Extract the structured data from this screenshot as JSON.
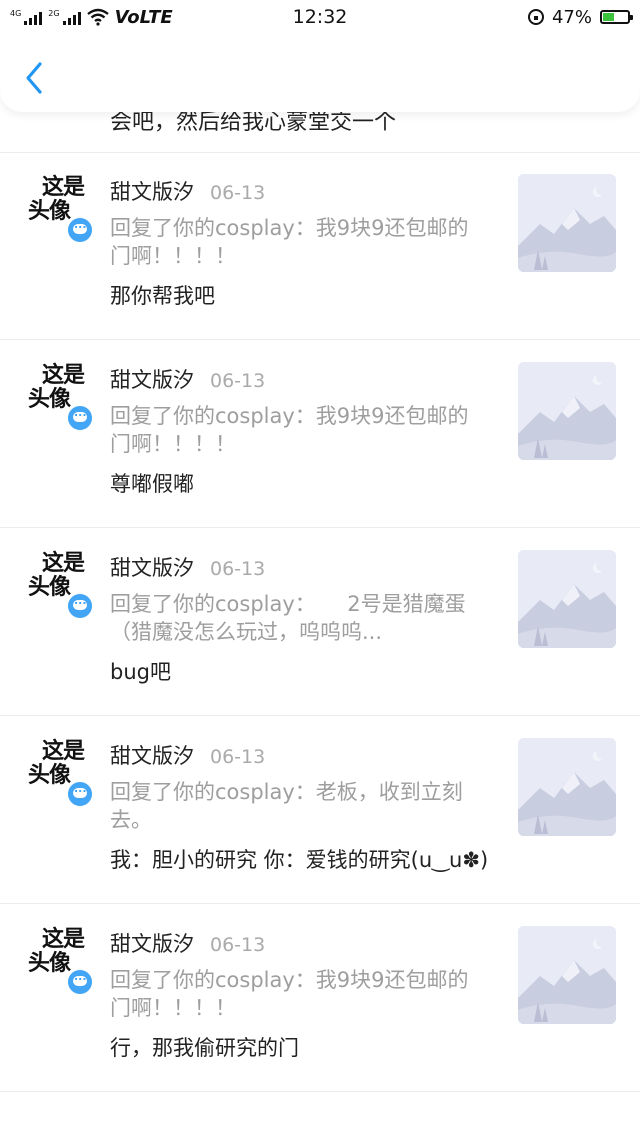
{
  "status_bar": {
    "signal1_label": "4G",
    "signal2_label": "2G",
    "volte": "VoLTE",
    "time": "12:32",
    "battery_percent": "47%",
    "battery_level": 0.47
  },
  "header": {
    "back_icon": "chevron-left-icon",
    "accent": "#2196f3"
  },
  "partial_row": {
    "text": "会吧，然后给我心蒙堂交一个"
  },
  "items": [
    {
      "name": "甜文版汐",
      "date": "06-13",
      "quote": "回复了你的cosplay：我9块9还包邮的门啊！！！！",
      "reply": "那你帮我吧"
    },
    {
      "name": "甜文版汐",
      "date": "06-13",
      "quote": "回复了你的cosplay：我9块9还包邮的门啊！！！！",
      "reply": "尊嘟假嘟"
    },
    {
      "name": "甜文版汐",
      "date": "06-13",
      "quote": "回复了你的cosplay：　　2号是猎魔蛋（猎魔没怎么玩过，呜呜呜...",
      "reply": "bug吧"
    },
    {
      "name": "甜文版汐",
      "date": "06-13",
      "quote": "回复了你的cosplay：老板，收到立刻去。",
      "reply": "我：胆小的研究  你：爱钱的研究(u‿u✽)"
    },
    {
      "name": "甜文版汐",
      "date": "06-13",
      "quote": "回复了你的cosplay：我9块9还包邮的门啊！！！！",
      "reply": "行，那我偷研究的门"
    }
  ],
  "avatar": {
    "calligraphy": [
      "这是",
      "头像"
    ],
    "badge_icon": "chat-bubble-icon",
    "badge_color": "#42a5f5"
  },
  "thumbnail": {
    "icon": "mountain-placeholder-icon"
  }
}
